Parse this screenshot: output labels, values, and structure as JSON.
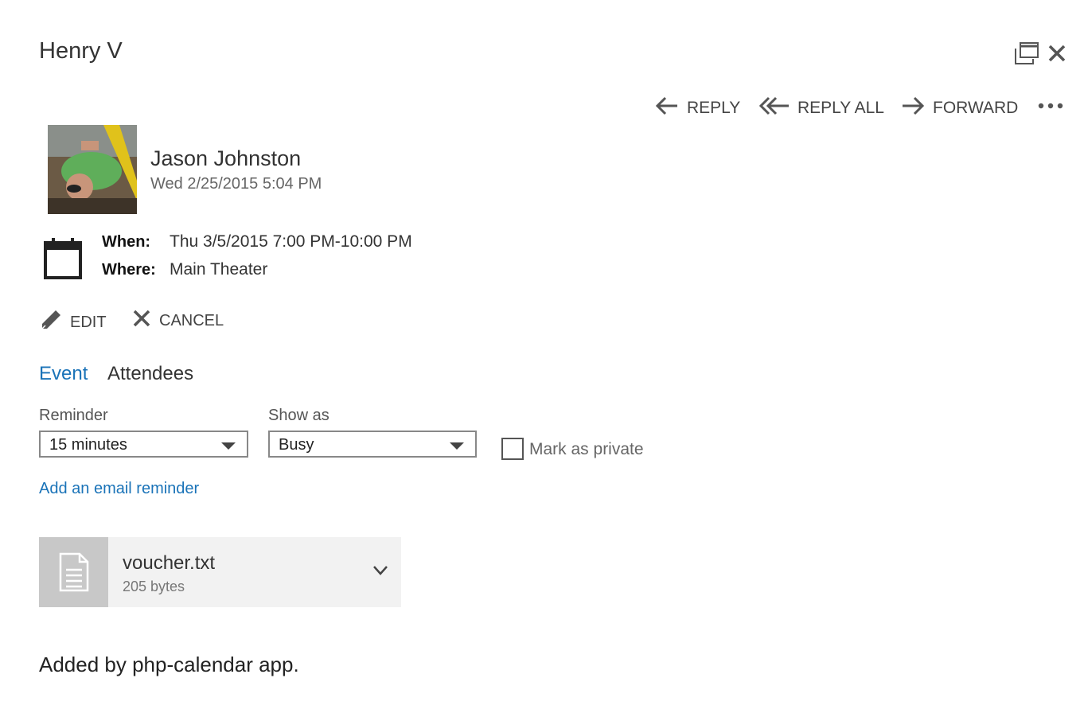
{
  "window": {
    "title": "Henry V",
    "popout_icon": "popout-icon",
    "close_icon": "close-icon"
  },
  "actions": {
    "reply": "REPLY",
    "reply_all": "REPLY ALL",
    "forward": "FORWARD",
    "more_icon": "more-icon"
  },
  "message": {
    "sender": "Jason Johnston",
    "sent": "Wed 2/25/2015 5:04 PM"
  },
  "event": {
    "when_label": "When:",
    "when_value": "Thu 3/5/2015 7:00 PM-10:00 PM",
    "where_label": "Where:",
    "where_value": "Main Theater"
  },
  "commands": {
    "edit": "EDIT",
    "cancel": "CANCEL"
  },
  "tabs": [
    {
      "label": "Event",
      "active": true
    },
    {
      "label": "Attendees",
      "active": false
    }
  ],
  "options": {
    "reminder_label": "Reminder",
    "reminder_value": "15 minutes",
    "show_as_label": "Show as",
    "show_as_value": "Busy",
    "private_label": "Mark as private",
    "private_checked": false,
    "email_reminder_link": "Add an email reminder"
  },
  "attachment": {
    "name": "voucher.txt",
    "size": "205 bytes"
  },
  "body": {
    "text": "Added by php-calendar app."
  },
  "colors": {
    "accent": "#1a73b8",
    "text": "#333333"
  }
}
